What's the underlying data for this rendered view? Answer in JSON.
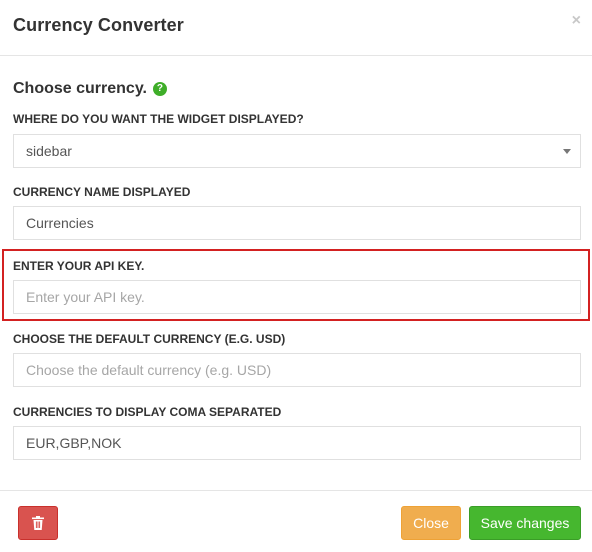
{
  "modal": {
    "title": "Currency Converter",
    "close_symbol": "×"
  },
  "section": {
    "heading": "Choose currency.",
    "help_icon": "?"
  },
  "fields": {
    "widget_location": {
      "label": "WHERE DO YOU WANT THE WIDGET DISPLAYED?",
      "value": "sidebar"
    },
    "currency_name": {
      "label": "CURRENCY NAME DISPLAYED",
      "value": "Currencies"
    },
    "api_key": {
      "label": "ENTER YOUR API KEY.",
      "placeholder": "Enter your API key."
    },
    "default_currency": {
      "label": "CHOOSE THE DEFAULT CURRENCY (E.G. USD)",
      "placeholder": "Choose the default currency (e.g. USD)"
    },
    "currencies_list": {
      "label": "CURRENCIES TO DISPLAY COMA SEPARATED",
      "value": "EUR,GBP,NOK"
    }
  },
  "footer": {
    "close_label": "Close",
    "save_label": "Save changes",
    "delete_icon": "trash-icon"
  },
  "colors": {
    "help_icon": "#3fae29",
    "highlight_border": "#d32121",
    "delete_button": "#d9534f",
    "close_button": "#f0ad4e",
    "save_button": "#46b72f"
  }
}
